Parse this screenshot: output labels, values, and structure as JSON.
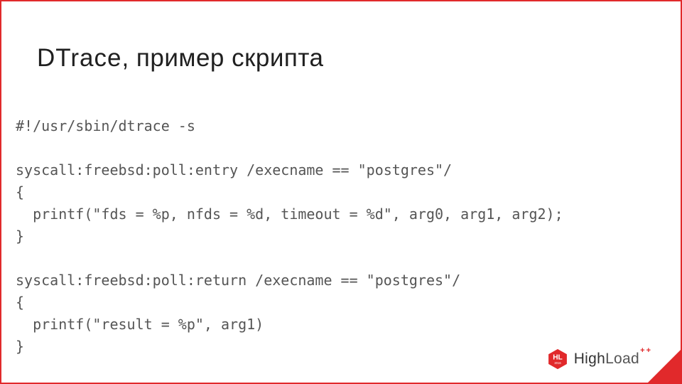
{
  "title_part1": "DTrace",
  "title_sep": ", ",
  "title_part2": "пример скрипта",
  "code_lines": [
    "#!/usr/sbin/dtrace -s",
    "",
    "syscall:freebsd:poll:entry /execname == \"postgres\"/",
    "{",
    "  printf(\"fds = %p, nfds = %d, timeout = %d\", arg0, arg1, arg2);",
    "}",
    "",
    "syscall:freebsd:poll:return /execname == \"postgres\"/",
    "{",
    "  printf(\"result = %p\", arg1)",
    "}"
  ],
  "logo": {
    "badge_text": "HL",
    "badge_year": "2016",
    "brand_high": "High",
    "brand_load": "Load",
    "brand_suffix": "++"
  },
  "colors": {
    "accent": "#e1292b"
  }
}
